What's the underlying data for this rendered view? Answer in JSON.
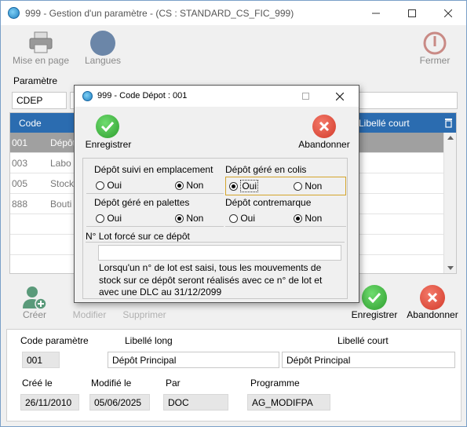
{
  "window": {
    "title": "999 - Gestion d'un paramètre - (CS : STANDARD_CS_FIC_999)"
  },
  "toolbar": {
    "mise_en_page": "Mise en page",
    "langues": "Langues",
    "fermer": "Fermer"
  },
  "param": {
    "label": "Paramètre",
    "code_value": "CDEP"
  },
  "grid": {
    "col_code": "Code",
    "col_libelle_court": "Libellé court",
    "rows": [
      {
        "code": "001",
        "libelle": "Dépôt"
      },
      {
        "code": "003",
        "libelle": "Labo"
      },
      {
        "code": "005",
        "libelle": "Stock"
      },
      {
        "code": "888",
        "libelle": "Bouti"
      }
    ]
  },
  "actions": {
    "creer": "Créer",
    "modifier": "Modifier",
    "supprimer": "Supprimer",
    "enregistrer": "Enregistrer",
    "abandonner": "Abandonner"
  },
  "detail": {
    "code_param_label": "Code paramètre",
    "libelle_long_label": "Libellé long",
    "libelle_court_label": "Libellé court",
    "code_param_value": "001",
    "libelle_long_value": "Dépôt Principal",
    "libelle_court_value": "Dépôt Principal",
    "cree_le_label": "Créé le",
    "modifie_le_label": "Modifié le",
    "par_label": "Par",
    "programme_label": "Programme",
    "cree_le_value": "26/11/2010",
    "modifie_le_value": "05/06/2025",
    "par_value": "DOC",
    "programme_value": "AG_MODIFPA"
  },
  "dialog": {
    "title": "999 - Code Dépot : 001",
    "enregistrer": "Enregistrer",
    "abandonner": "Abandonner",
    "q1": {
      "label": "Dépôt suivi en emplacement",
      "oui": "Oui",
      "non": "Non",
      "selected": "non"
    },
    "q2": {
      "label": "Dépôt géré en colis",
      "oui": "Oui",
      "non": "Non",
      "selected": "oui"
    },
    "q3": {
      "label": "Dépôt géré en palettes",
      "oui": "Oui",
      "non": "Non",
      "selected": "non"
    },
    "q4": {
      "label": "Dépôt contremarque",
      "oui": "Oui",
      "non": "Non",
      "selected": "non"
    },
    "lot_label": "N° Lot forcé sur ce dépôt",
    "lot_value": "",
    "lot_info": "Lorsqu'un n° de lot est saisi, tous les mouvements de stock sur ce dépôt seront réalisés avec ce n° de lot et avec une DLC au 31/12/2099"
  }
}
